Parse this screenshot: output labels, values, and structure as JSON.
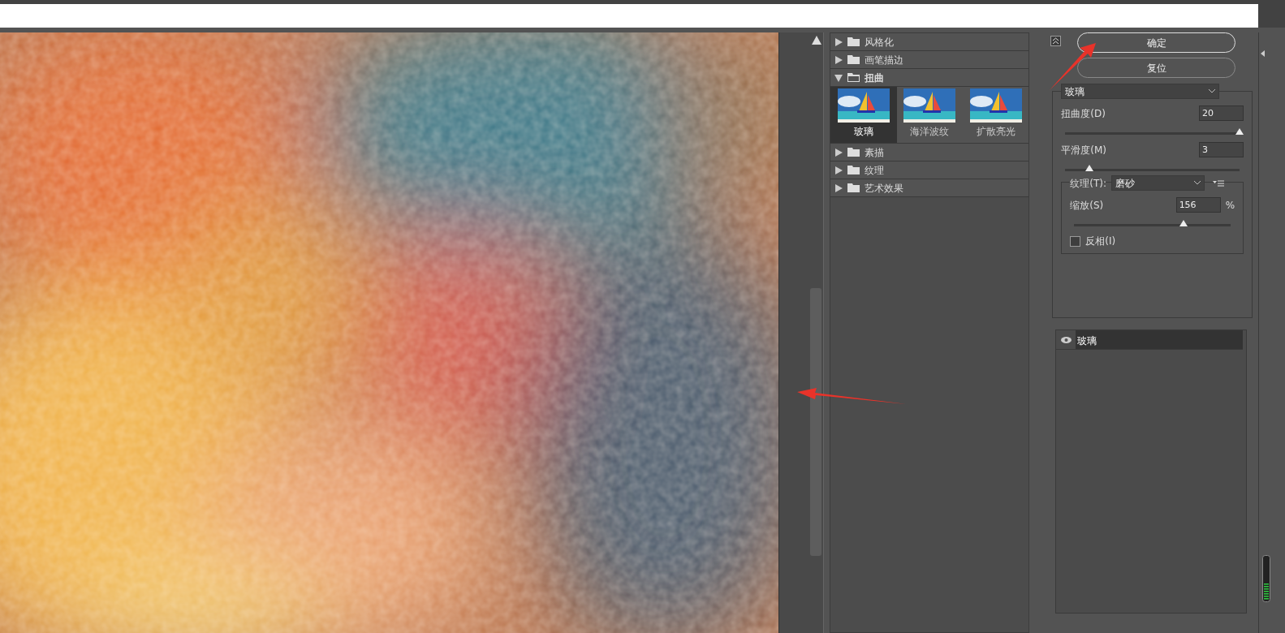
{
  "filter_tree": [
    {
      "label": "风格化",
      "expanded": false
    },
    {
      "label": "画笔描边",
      "expanded": false
    },
    {
      "label": "扭曲",
      "expanded": true,
      "children": [
        {
          "label": "玻璃",
          "selected": true
        },
        {
          "label": "海洋波纹",
          "selected": false
        },
        {
          "label": "扩散亮光",
          "selected": false
        }
      ]
    },
    {
      "label": "素描",
      "expanded": false
    },
    {
      "label": "纹理",
      "expanded": false
    },
    {
      "label": "艺术效果",
      "expanded": false
    }
  ],
  "buttons": [
    {
      "label": "确定",
      "selected": true
    },
    {
      "label": "复位",
      "selected": false
    }
  ],
  "settings": {
    "filter_select": "玻璃",
    "sliders": [
      {
        "label": "扭曲度(D)",
        "value": "20",
        "level": 1.0
      },
      {
        "label": "平滑度(M)",
        "value": "3",
        "level": 0.14
      }
    ],
    "texture": {
      "label": "纹理(T):",
      "select": "磨砂",
      "scale": {
        "label": "缩放(S)",
        "value": "156",
        "unit": "%",
        "level": 0.7
      },
      "invert": {
        "label": "反相(I)",
        "checked": false
      }
    }
  },
  "layers": [
    {
      "label": "玻璃",
      "visible": true
    }
  ]
}
